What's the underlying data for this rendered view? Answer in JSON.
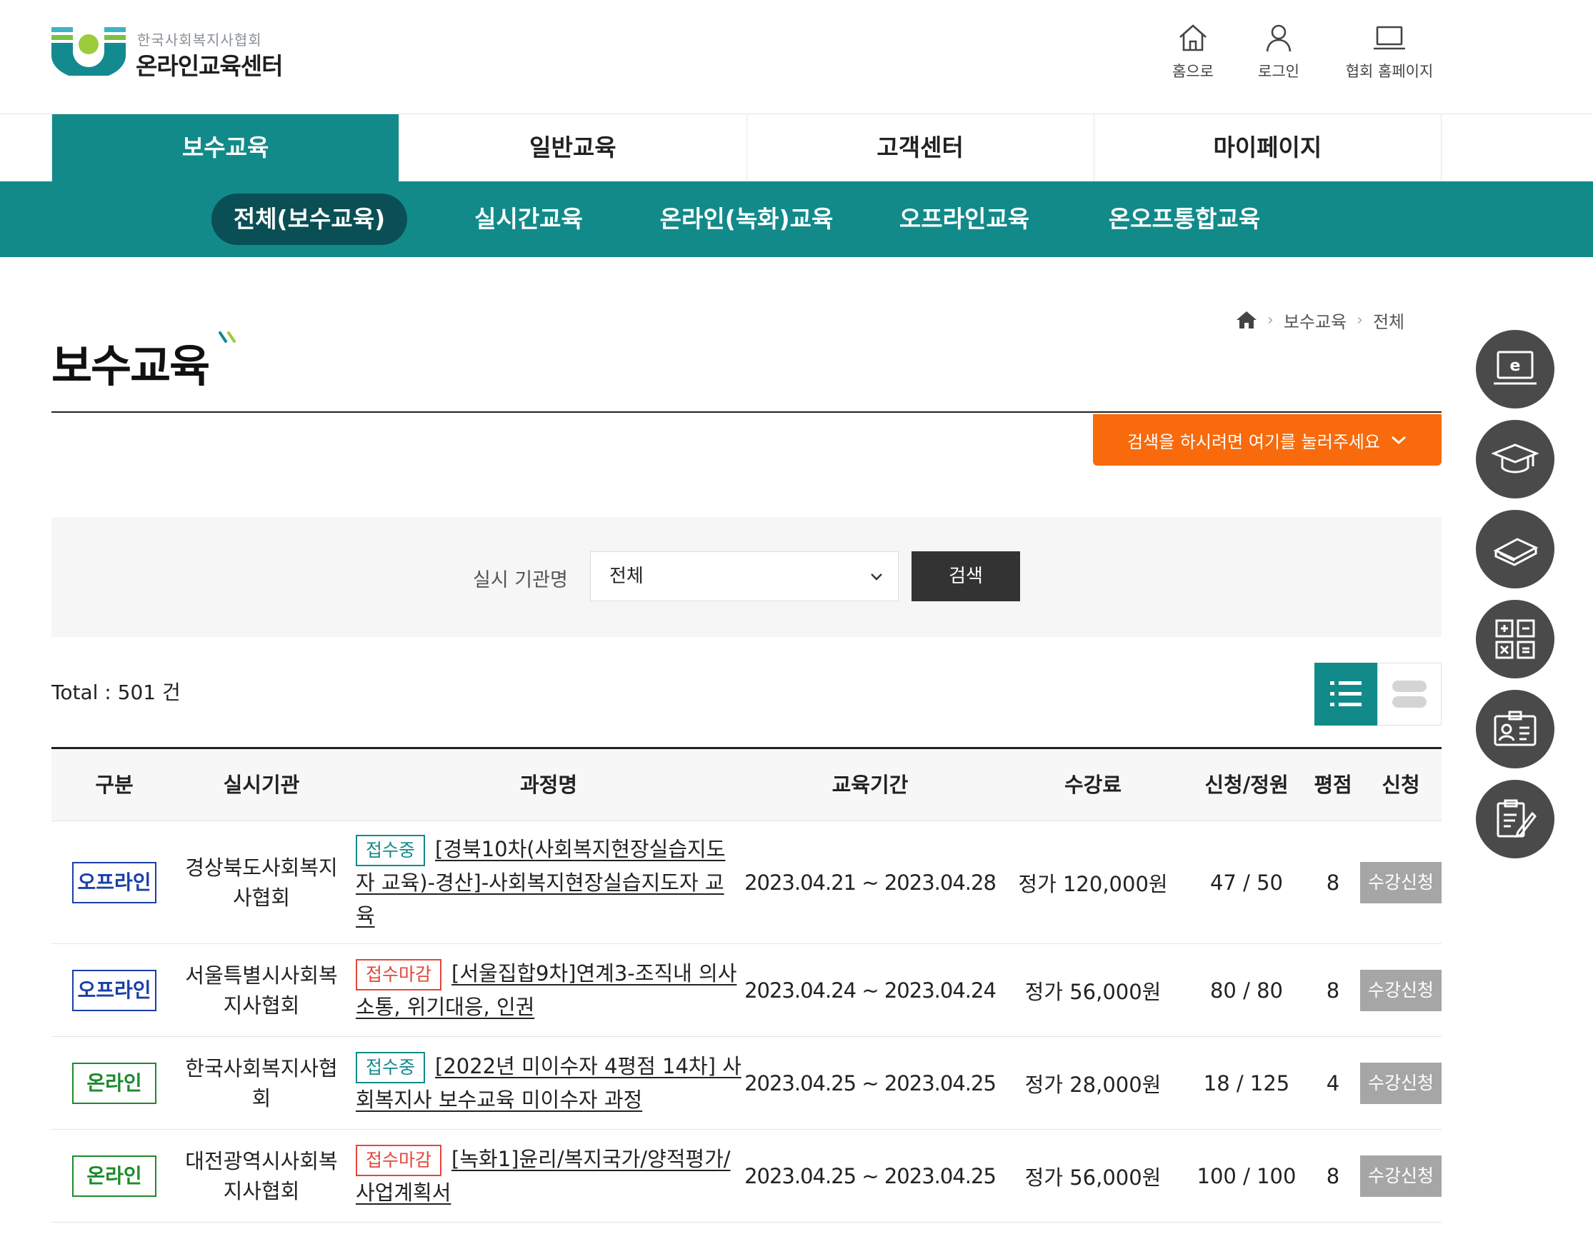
{
  "header": {
    "logo_sub": "한국사회복지사협회",
    "logo_main": "온라인교육센터",
    "util": [
      {
        "label": "홈으로",
        "icon": "home-icon"
      },
      {
        "label": "로그인",
        "icon": "user-icon"
      },
      {
        "label": "협회 홈페이지",
        "icon": "laptop-icon"
      }
    ]
  },
  "gnb": [
    "보수교육",
    "일반교육",
    "고객센터",
    "마이페이지"
  ],
  "lnb": [
    "전체(보수교육)",
    "실시간교육",
    "온라인(녹화)교육",
    "오프라인교육",
    "온오프통합교육"
  ],
  "breadcrumb": {
    "level1": "보수교육",
    "level2": "전체"
  },
  "page_title": "보수교육",
  "search_toggle": "검색을 하시려면 여기를 눌러주세요",
  "search": {
    "label": "실시 기관명",
    "selected": "전체",
    "button": "검색"
  },
  "total": "Total : 501 건",
  "table": {
    "headers": [
      "구분",
      "실시기관",
      "과정명",
      "교육기간",
      "수강료",
      "신청/정원",
      "평점",
      "신청"
    ],
    "rows": [
      {
        "type": "오프라인",
        "org": "경상북도사회복지사협회",
        "status": "접수중",
        "course": "[경북10차(사회복지현장실습지도자 교육)-경산]-사회복지현장실습지도자 교육",
        "period": "2023.04.21 ~ 2023.04.28",
        "fee": "정가 120,000원",
        "seats": "47 / 50",
        "score": "8",
        "apply": "수강신청"
      },
      {
        "type": "오프라인",
        "org": "서울특별시사회복지사협회",
        "status": "접수마감",
        "course": "[서울집합9차]연계3-조직내 의사소통, 위기대응, 인권",
        "period": "2023.04.24 ~ 2023.04.24",
        "fee": "정가 56,000원",
        "seats": "80 / 80",
        "score": "8",
        "apply": "수강신청"
      },
      {
        "type": "온라인",
        "org": "한국사회복지사협회",
        "status": "접수중",
        "course": "[2022년 미이수자 4평점 14차] 사회복지사 보수교육 미이수자 과정",
        "period": "2023.04.25 ~ 2023.04.25",
        "fee": "정가 28,000원",
        "seats": "18 / 125",
        "score": "4",
        "apply": "수강신청"
      },
      {
        "type": "온라인",
        "org": "대전광역시사회복지사협회",
        "status": "접수마감",
        "course": "[녹화1]윤리/복지국가/양적평가/사업계획서",
        "period": "2023.04.25 ~ 2023.04.25",
        "fee": "정가 56,000원",
        "seats": "100 / 100",
        "score": "8",
        "apply": "수강신청"
      }
    ]
  },
  "quick_menu": [
    "e-learning-icon",
    "graduation-cap-icon",
    "books-icon",
    "calculator-icon",
    "id-card-icon",
    "checklist-icon"
  ],
  "colors": {
    "primary": "#128a8a",
    "primary_dark": "#0a4f55",
    "accent": "#f86a0c",
    "offline": "#1a3fa8",
    "online": "#1d8a2c",
    "closed": "#e2473a"
  }
}
